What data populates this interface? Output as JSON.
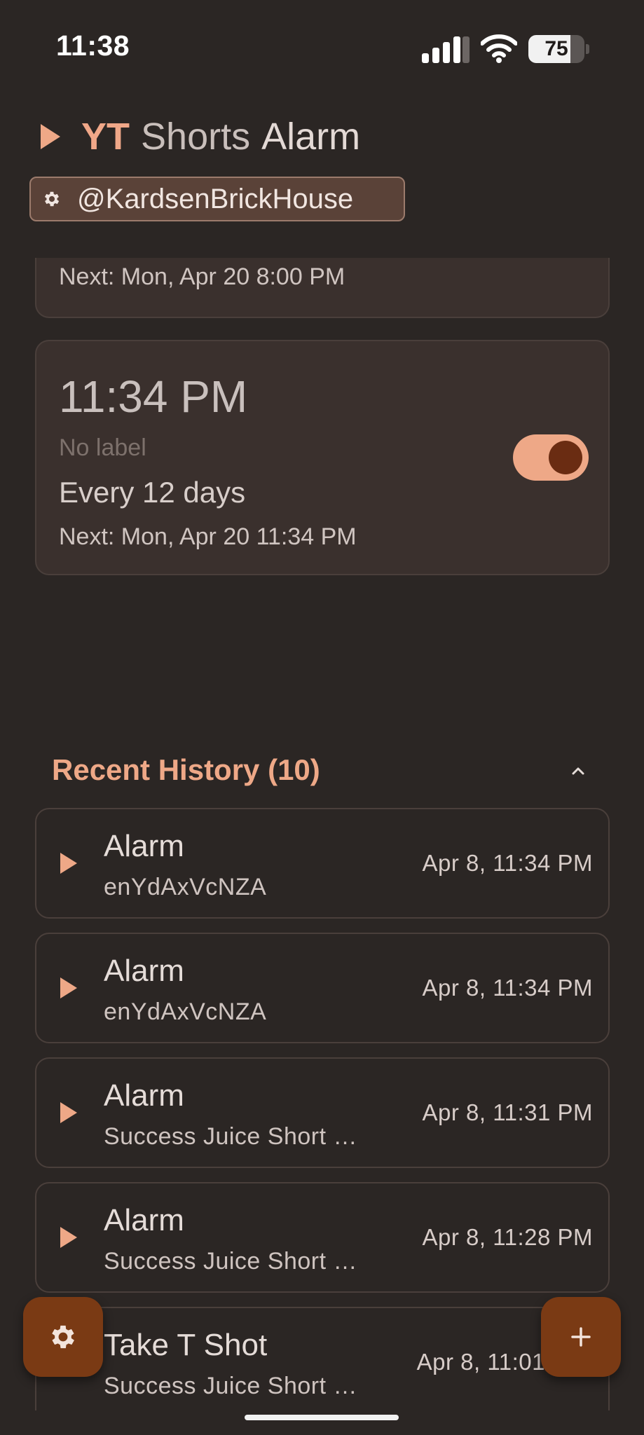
{
  "status_bar": {
    "time": "11:38",
    "battery_level": "75",
    "battery_fraction": 0.75
  },
  "header": {
    "title_yt": "YT",
    "title_shorts": "Shorts",
    "title_alarm": "Alarm",
    "account": "@KardsenBrickHouse"
  },
  "alarms": [
    {
      "next": "Next: Mon, Apr 20 8:00 PM"
    },
    {
      "time": "11:34 PM",
      "label": "No label",
      "repeat": "Every 12 days",
      "next": "Next: Mon, Apr 20 11:34 PM",
      "enabled": true
    }
  ],
  "history": {
    "title": "Recent History (10)",
    "items": [
      {
        "title": "Alarm",
        "subtitle": "enYdAxVcNZA",
        "time": "Apr 8, 11:34 PM"
      },
      {
        "title": "Alarm",
        "subtitle": "enYdAxVcNZA",
        "time": "Apr 8, 11:34 PM"
      },
      {
        "title": "Alarm",
        "subtitle": "Success Juice Short …",
        "time": "Apr 8, 11:31 PM"
      },
      {
        "title": "Alarm",
        "subtitle": "Success Juice Short …",
        "time": "Apr 8, 11:28 PM"
      },
      {
        "title": "Take T Shot",
        "subtitle": "Success Juice Short …",
        "time": "Apr 8, 11:01"
      }
    ]
  },
  "colors": {
    "background": "#2b2624",
    "accent": "#eea887",
    "fab": "#7a3a14",
    "card": "#3a302d"
  },
  "icons": {
    "settings_fab": "gear-icon",
    "add_fab": "plus-icon",
    "history_item": "play-icon",
    "collapse": "chevron-up-icon"
  }
}
